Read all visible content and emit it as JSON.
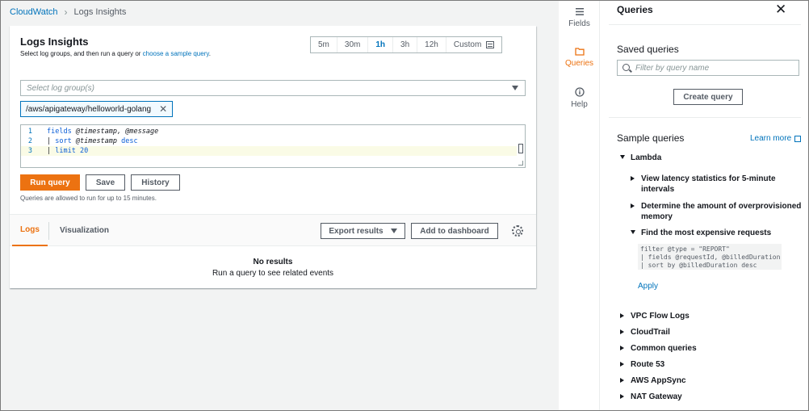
{
  "breadcrumb": {
    "root": "CloudWatch",
    "current": "Logs Insights"
  },
  "card": {
    "title": "Logs Insights",
    "subtitle_prefix": "Select log groups, and then run a query or ",
    "subtitle_link": "choose a sample query",
    "subtitle_suffix": "."
  },
  "time_range": {
    "options": [
      "5m",
      "30m",
      "1h",
      "3h",
      "12h",
      "Custom"
    ],
    "selected": "1h"
  },
  "log_group": {
    "placeholder": "Select log group(s)",
    "token": "/aws/apigateway/helloworld-golang"
  },
  "editor": {
    "lines": [
      {
        "num": "1",
        "kw": "fields",
        "rest": " @timestamp, @message"
      },
      {
        "num": "2",
        "pipe": "| ",
        "kw": "sort",
        "rest": " @timestamp ",
        "kw2": "desc"
      },
      {
        "num": "3",
        "pipe": "| ",
        "kw": "limit",
        "num_val": " 20"
      }
    ]
  },
  "actions": {
    "run": "Run query",
    "save": "Save",
    "history": "History",
    "note": "Queries are allowed to run for up to 15 minutes."
  },
  "results": {
    "tabs": [
      "Logs",
      "Visualization"
    ],
    "export": "Export results",
    "dashboard": "Add to dashboard",
    "empty_title": "No results",
    "empty_sub": "Run a query to see related events"
  },
  "rail": {
    "fields": "Fields",
    "queries": "Queries",
    "help": "Help"
  },
  "panel": {
    "title": "Queries",
    "saved_title": "Saved queries",
    "filter_placeholder": "Filter by query name",
    "create": "Create query",
    "sample_title": "Sample queries",
    "learn_more": "Learn more",
    "lambda": {
      "label": "Lambda",
      "items": [
        {
          "l1": "View latency statistics for 5-minute",
          "l2": "intervals"
        },
        {
          "l1": "Determine the amount of overprovisioned",
          "l2": "memory"
        },
        {
          "l1": "Find the most expensive requests"
        }
      ],
      "code": "filter @type = \"REPORT\"\n| fields @requestId, @billedDuration\n| sort by @billedDuration desc",
      "apply": "Apply"
    },
    "categories": [
      "VPC Flow Logs",
      "CloudTrail",
      "Common queries",
      "Route 53",
      "AWS AppSync",
      "NAT Gateway"
    ]
  }
}
